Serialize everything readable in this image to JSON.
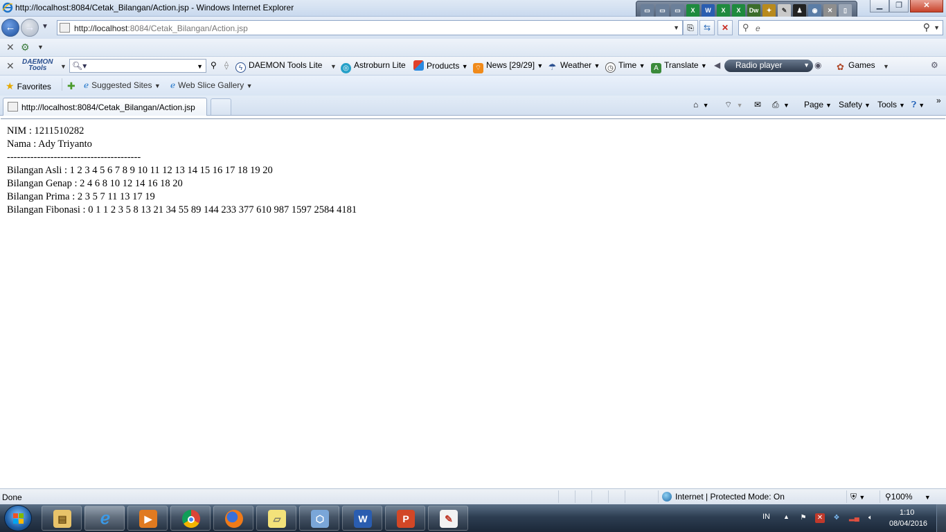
{
  "window": {
    "title": "http://localhost:8084/Cetak_Bilangan/Action.jsp - Windows Internet Explorer"
  },
  "address": {
    "url_host": "http://localhost",
    "url_rest": ":8084/Cetak_Bilangan/Action.jsp",
    "search_placeholder": "e"
  },
  "daemon_toolbar": {
    "logo_line1": "DAEMON",
    "logo_line2": "Tools",
    "items": [
      {
        "label": "DAEMON Tools Lite",
        "icon": "daemon-icon"
      },
      {
        "label": "Astroburn Lite",
        "icon": "astroburn-icon"
      },
      {
        "label": "Products",
        "icon": "products-icon"
      },
      {
        "label": "News [29/29]",
        "icon": "rss-icon"
      },
      {
        "label": "Weather",
        "icon": "umbrella-icon"
      },
      {
        "label": "Time",
        "icon": "clock-icon"
      },
      {
        "label": "Translate",
        "icon": "translate-icon"
      },
      {
        "label": "Games",
        "icon": "games-icon"
      }
    ],
    "radio_label": "Radio player"
  },
  "favorites_bar": {
    "favorites_label": "Favorites",
    "suggested_sites": "Suggested Sites",
    "web_slice_gallery": "Web Slice Gallery"
  },
  "tab": {
    "label": "http://localhost:8084/Cetak_Bilangan/Action.jsp"
  },
  "command_bar": {
    "page": "Page",
    "safety": "Safety",
    "tools": "Tools"
  },
  "content": {
    "lines": [
      "NIM : 1211510282",
      "Nama : Ady Triyanto",
      "----------------------------------------",
      "Bilangan Asli : 1 2 3 4 5 6 7 8 9 10 11 12 13 14 15 16 17 18 19 20",
      "Bilangan Genap : 2 4 6 8 10 12 14 16 18 20",
      "Bilangan Prima : 2 3 5 7 11 13 17 19",
      "Bilangan Fibonasi : 0 1 1 2 3 5 8 13 21 34 55 89 144 233 377 610 987 1597 2584 4181"
    ]
  },
  "statusbar": {
    "status": "Done",
    "zone": "Internet | Protected Mode: On",
    "zoom": "100%"
  },
  "taskbar": {
    "language": "IN",
    "time": "1:10",
    "date": "08/04/2016"
  },
  "colors": {
    "accent": "#1d4f9c",
    "taskbar": "#2d3e52"
  }
}
